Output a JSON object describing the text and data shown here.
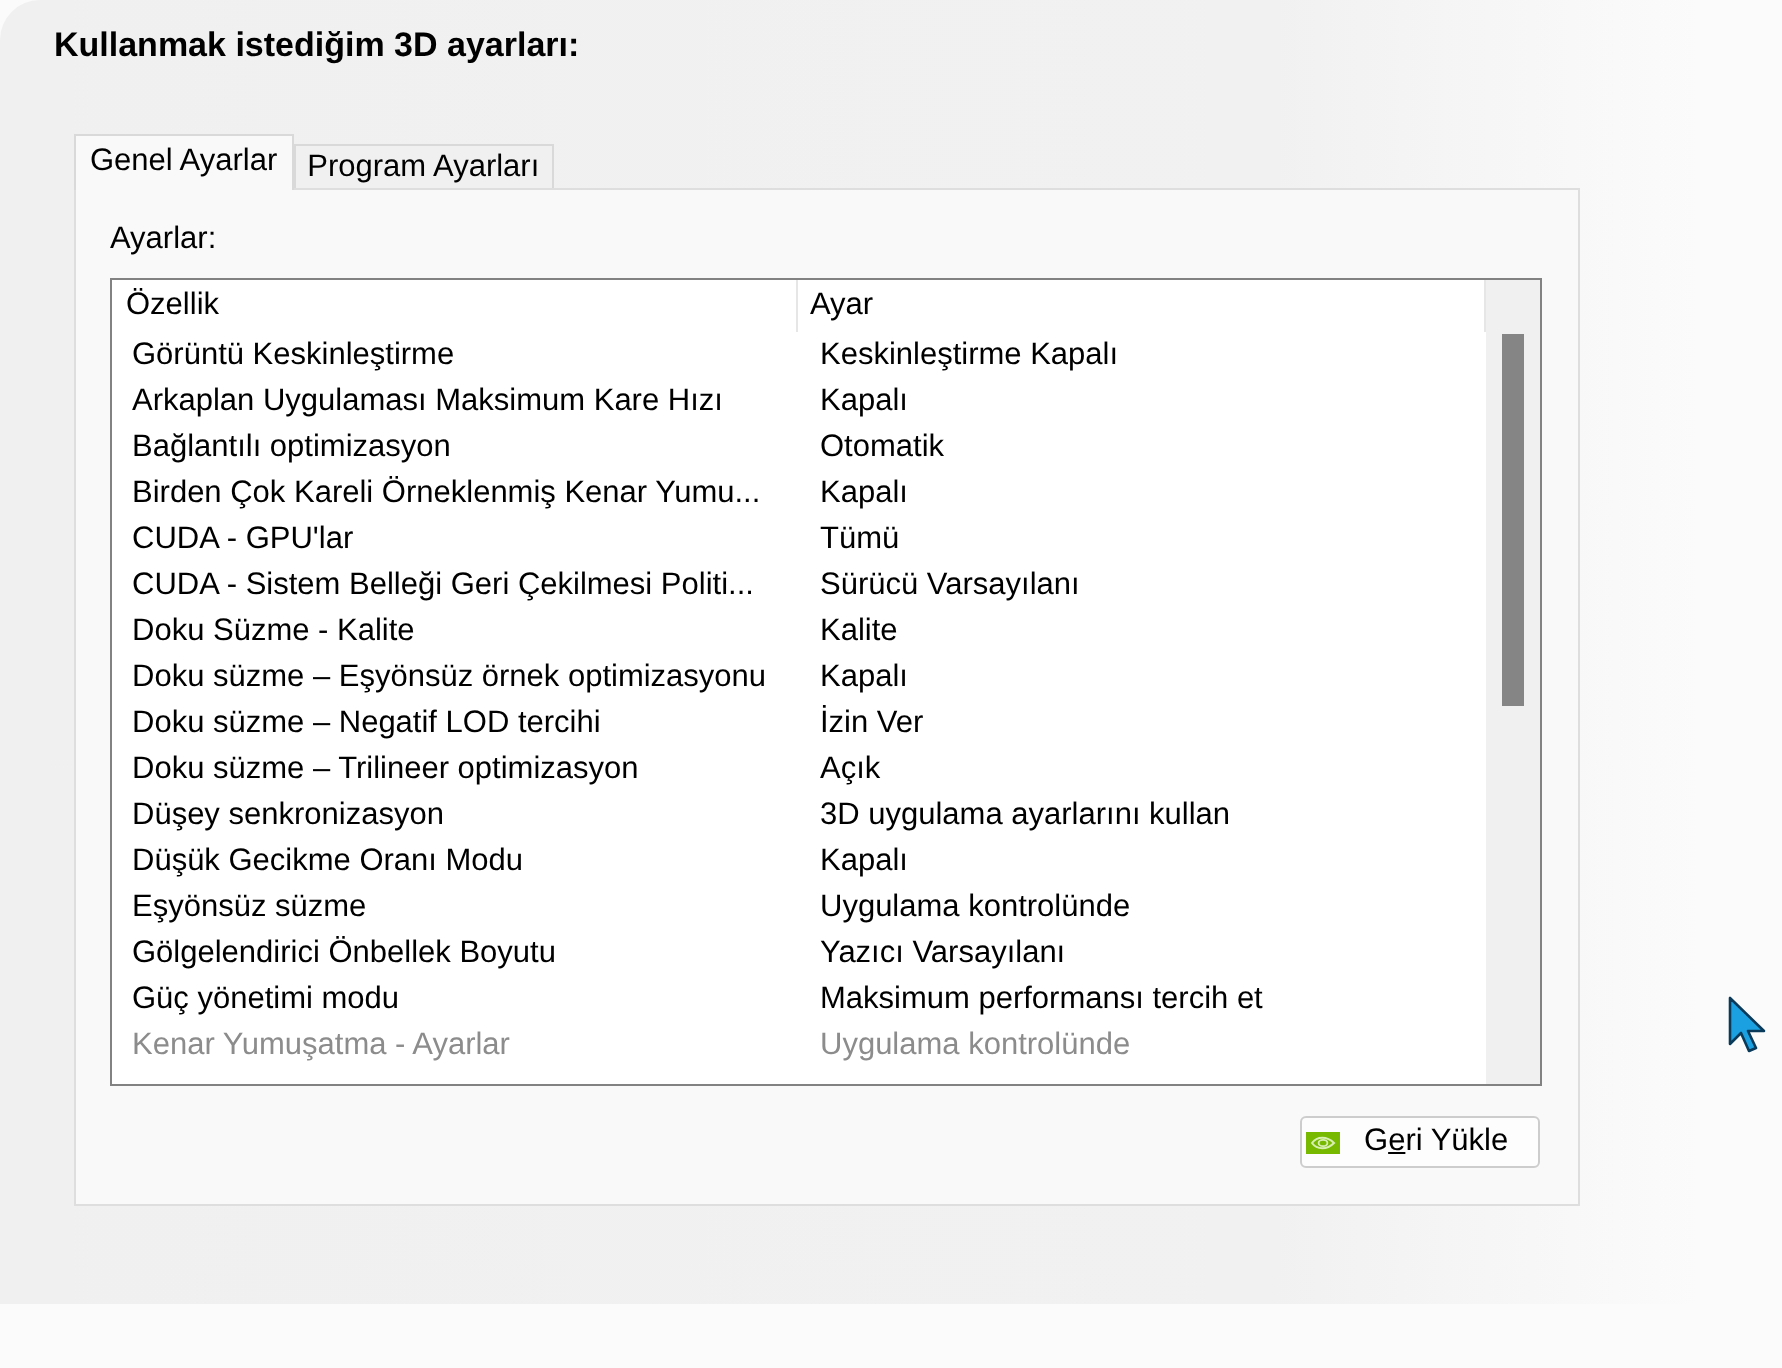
{
  "heading": "Kullanmak istediğim 3D ayarları:",
  "tabs": [
    {
      "label": "Genel Ayarlar",
      "selected": true
    },
    {
      "label": "Program Ayarları",
      "selected": false
    }
  ],
  "settings_label": "Ayarlar:",
  "table": {
    "columns": [
      "Özellik",
      "Ayar"
    ],
    "rows": [
      {
        "feature": "Görüntü Keskinleştirme",
        "setting": "Keskinleştirme Kapalı",
        "disabled": false
      },
      {
        "feature": "Arkaplan Uygulaması Maksimum Kare Hızı",
        "setting": "Kapalı",
        "disabled": false
      },
      {
        "feature": "Bağlantılı optimizasyon",
        "setting": "Otomatik",
        "disabled": false
      },
      {
        "feature": "Birden Çok Kareli Örneklenmiş Kenar Yumu...",
        "setting": "Kapalı",
        "disabled": false
      },
      {
        "feature": "CUDA - GPU'lar",
        "setting": "Tümü",
        "disabled": false
      },
      {
        "feature": "CUDA - Sistem Belleği Geri Çekilmesi Politi...",
        "setting": "Sürücü Varsayılanı",
        "disabled": false
      },
      {
        "feature": "Doku Süzme - Kalite",
        "setting": "Kalite",
        "disabled": false
      },
      {
        "feature": "Doku süzme – Eşyönsüz örnek optimizasyonu",
        "setting": "Kapalı",
        "disabled": false
      },
      {
        "feature": "Doku süzme – Negatif LOD tercihi",
        "setting": "İzin Ver",
        "disabled": false
      },
      {
        "feature": "Doku süzme – Trilineer optimizasyon",
        "setting": "Açık",
        "disabled": false
      },
      {
        "feature": "Düşey senkronizasyon",
        "setting": "3D uygulama ayarlarını kullan",
        "disabled": false
      },
      {
        "feature": "Düşük Gecikme Oranı Modu",
        "setting": "Kapalı",
        "disabled": false
      },
      {
        "feature": "Eşyönsüz süzme",
        "setting": "Uygulama kontrolünde",
        "disabled": false
      },
      {
        "feature": "Gölgelendirici Önbellek Boyutu",
        "setting": "Yazıcı Varsayılanı",
        "disabled": false
      },
      {
        "feature": "Güç yönetimi modu",
        "setting": "Maksimum performansı tercih et",
        "disabled": false
      },
      {
        "feature": "Kenar Yumuşatma - Ayarlar",
        "setting": "Uygulama kontrolünde",
        "disabled": true
      }
    ]
  },
  "restore_button": {
    "label_before": "G",
    "access_key": "e",
    "label_after": "ri Yükle"
  }
}
